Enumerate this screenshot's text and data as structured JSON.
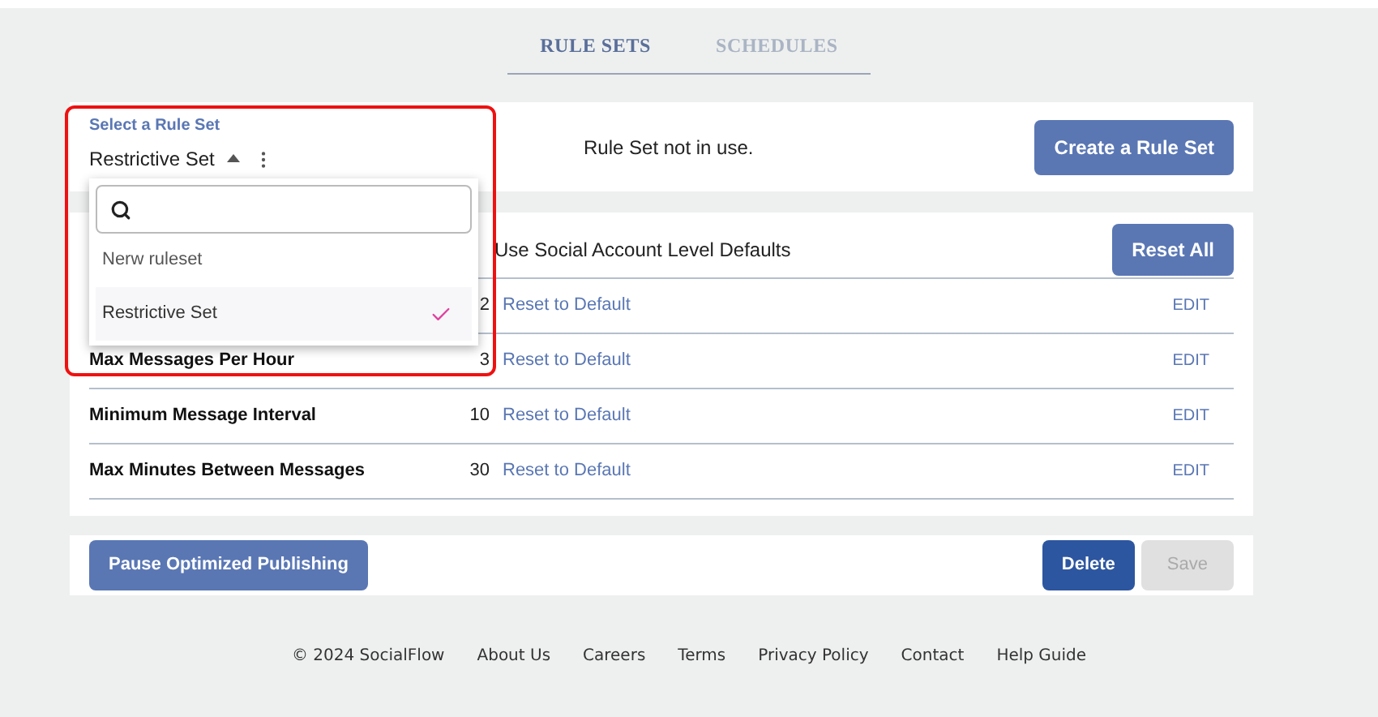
{
  "tabs": [
    {
      "label": "RULE SETS",
      "selected": true
    },
    {
      "label": "SCHEDULES",
      "selected": false
    }
  ],
  "rule_set_select": {
    "label": "Select a Rule Set",
    "value": "Restrictive Set",
    "expanded": true
  },
  "status": "Rule Set not in use.",
  "create_button": "Create a Rule Set",
  "dropdown": {
    "options": [
      {
        "label": "Nerw ruleset",
        "selected": false
      },
      {
        "label": "Restrictive Set",
        "selected": true
      }
    ]
  },
  "defaults_row": {
    "text": "Use Social Account Level Defaults",
    "button": "Reset All"
  },
  "rules": [
    {
      "value": "2",
      "reset": "Reset to Default",
      "edit": "EDIT"
    },
    {
      "name": "Max Messages Per Hour",
      "value": "3",
      "reset": "Reset to Default",
      "edit": "EDIT"
    },
    {
      "name": "Minimum Message Interval",
      "value": "10",
      "reset": "Reset to Default",
      "edit": "EDIT"
    },
    {
      "name": "Max Minutes Between Messages",
      "value": "30",
      "reset": "Reset to Default",
      "edit": "EDIT"
    }
  ],
  "actions": {
    "pause": "Pause Optimized Publishing",
    "delete": "Delete",
    "save": {
      "label": "Save",
      "disabled": true
    }
  },
  "footer": [
    "© 2024 SocialFlow",
    "About Us",
    "Careers",
    "Terms",
    "Privacy Policy",
    "Contact",
    "Help Guide"
  ]
}
